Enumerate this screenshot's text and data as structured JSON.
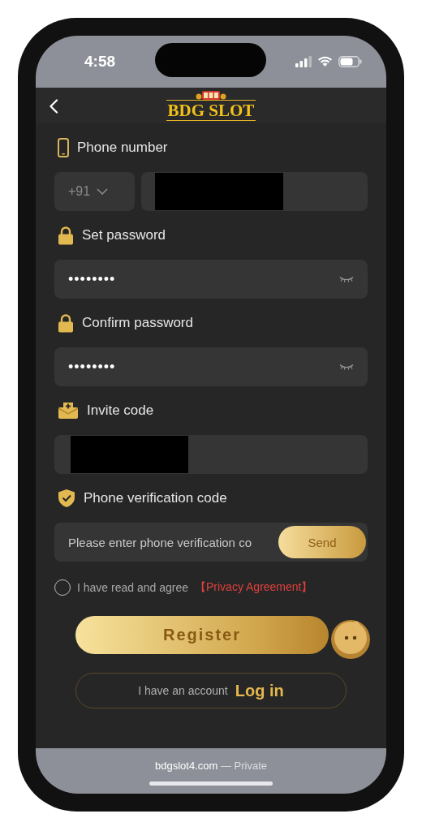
{
  "status_bar": {
    "time": "4:58"
  },
  "header": {
    "logo": "BDG SLOT"
  },
  "form": {
    "fields": [
      {
        "kind": "phone",
        "label": "Phone number",
        "country_code": "+91",
        "redacted": true
      },
      {
        "kind": "password",
        "label": "Set password",
        "value": "••••••••"
      },
      {
        "kind": "password",
        "label": "Confirm password",
        "value": "••••••••"
      },
      {
        "kind": "invite",
        "label": "Invite code",
        "redacted": true
      },
      {
        "kind": "code",
        "label": "Phone verification code",
        "placeholder": "Please enter phone verification co",
        "button": "Send"
      }
    ],
    "agreement": {
      "checked": false,
      "text": "I have read and agree",
      "link": "【Privacy Agreement】"
    },
    "register_button": "Register",
    "login": {
      "prompt": "I have an account",
      "link": "Log in"
    }
  },
  "browser_bar": {
    "url": "bdgslot4.com",
    "suffix": "— Private"
  }
}
